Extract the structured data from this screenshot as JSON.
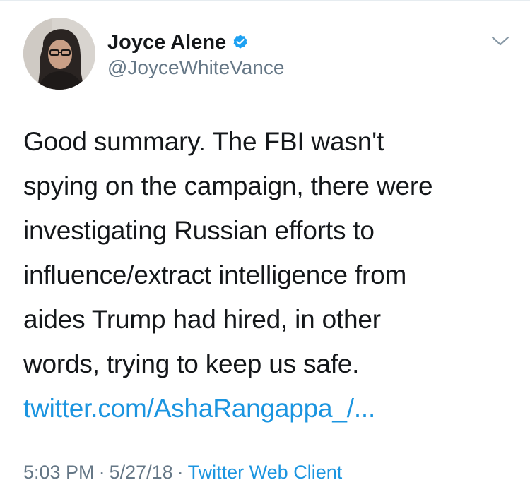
{
  "tweet": {
    "author": {
      "display_name": "Joyce Alene",
      "handle": "@JoyceWhiteVance",
      "verified": true,
      "verified_icon": "verified-badge-icon"
    },
    "text_lines": [
      "Good summary. The FBI wasn't",
      "spying on the campaign, there were",
      "investigating Russian efforts to",
      "influence/extract intelligence from",
      "aides Trump had hired, in other",
      "words, trying to keep us safe."
    ],
    "link_text": "twitter.com/AshaRangappa_/...",
    "time": "5:03 PM",
    "date": "5/27/18",
    "separator": "·",
    "client": "Twitter Web Client",
    "menu_icon": "chevron-down-icon"
  },
  "colors": {
    "text": "#14171a",
    "secondary": "#657786",
    "link": "#1b95e0",
    "verified": "#1da1f2",
    "divider": "#e6ecf0"
  }
}
